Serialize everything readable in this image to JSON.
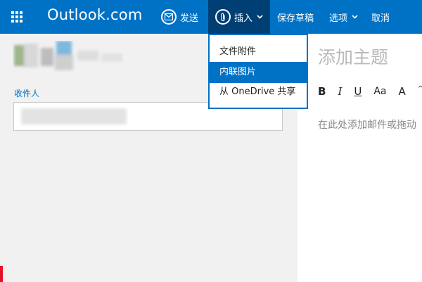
{
  "header": {
    "brand": "Outlook.com",
    "icons": {
      "app_launcher": "waffle-icon",
      "send": "send-envelope-icon",
      "insert": "paperclip-icon"
    },
    "commands": {
      "send": "发送",
      "insert": "插入",
      "save_draft": "保存草稿",
      "options": "选项",
      "cancel": "取消"
    },
    "colors": {
      "bar": "#0072c6",
      "active": "#003f73"
    }
  },
  "insert_menu": {
    "items": [
      "文件附件",
      "内联图片",
      "从 OneDrive 共享"
    ],
    "selected_index": 1
  },
  "compose": {
    "recipients_label": "收件人",
    "subject_placeholder": "添加主题",
    "body_placeholder": "在此处添加邮件或拖动",
    "format_toolbar": {
      "bold": "B",
      "italic": "I",
      "underline": "U",
      "font_size": "Aa",
      "grow_font": "A",
      "font_color": "A"
    }
  }
}
